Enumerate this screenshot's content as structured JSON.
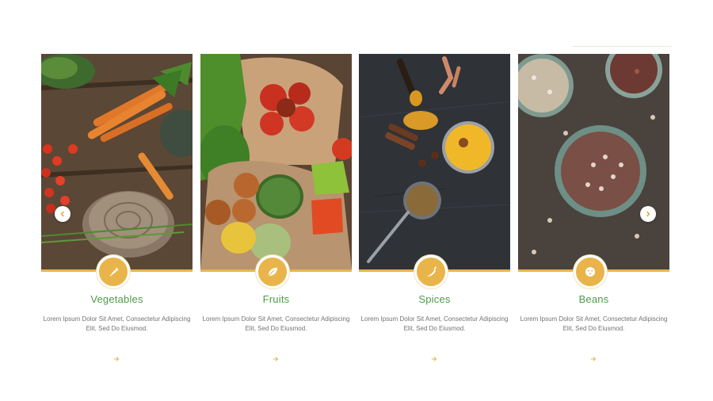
{
  "categories": [
    {
      "title": "Vegetables",
      "description": "Lorem Ipsum Dolor Sit Amet, Consectetur Adipiscing Elit, Sed Do Eiusmod.",
      "icon": "carrot-icon",
      "image": "vegetables-photo"
    },
    {
      "title": "Fruits",
      "description": "Lorem Ipsum Dolor Sit Amet, Consectetur Adipiscing Elit, Sed Do Eiusmod.",
      "icon": "leaf-icon",
      "image": "fruits-photo"
    },
    {
      "title": "Spices",
      "description": "Lorem Ipsum Dolor Sit Amet, Consectetur Adipiscing Elit, Sed Do Eiusmod.",
      "icon": "chili-icon",
      "image": "spices-photo"
    },
    {
      "title": "Beans",
      "description": "Lorem Ipsum Dolor Sit Amet, Consectetur Adipiscing Elit, Sed Do Eiusmod.",
      "icon": "beans-icon",
      "image": "beans-photo"
    }
  ],
  "navigation": {
    "prev_icon": "chevron-left-icon",
    "next_icon": "chevron-right-icon"
  },
  "colors": {
    "accent": "#e9b44a",
    "title": "#4f9b4a",
    "text": "#737373"
  }
}
